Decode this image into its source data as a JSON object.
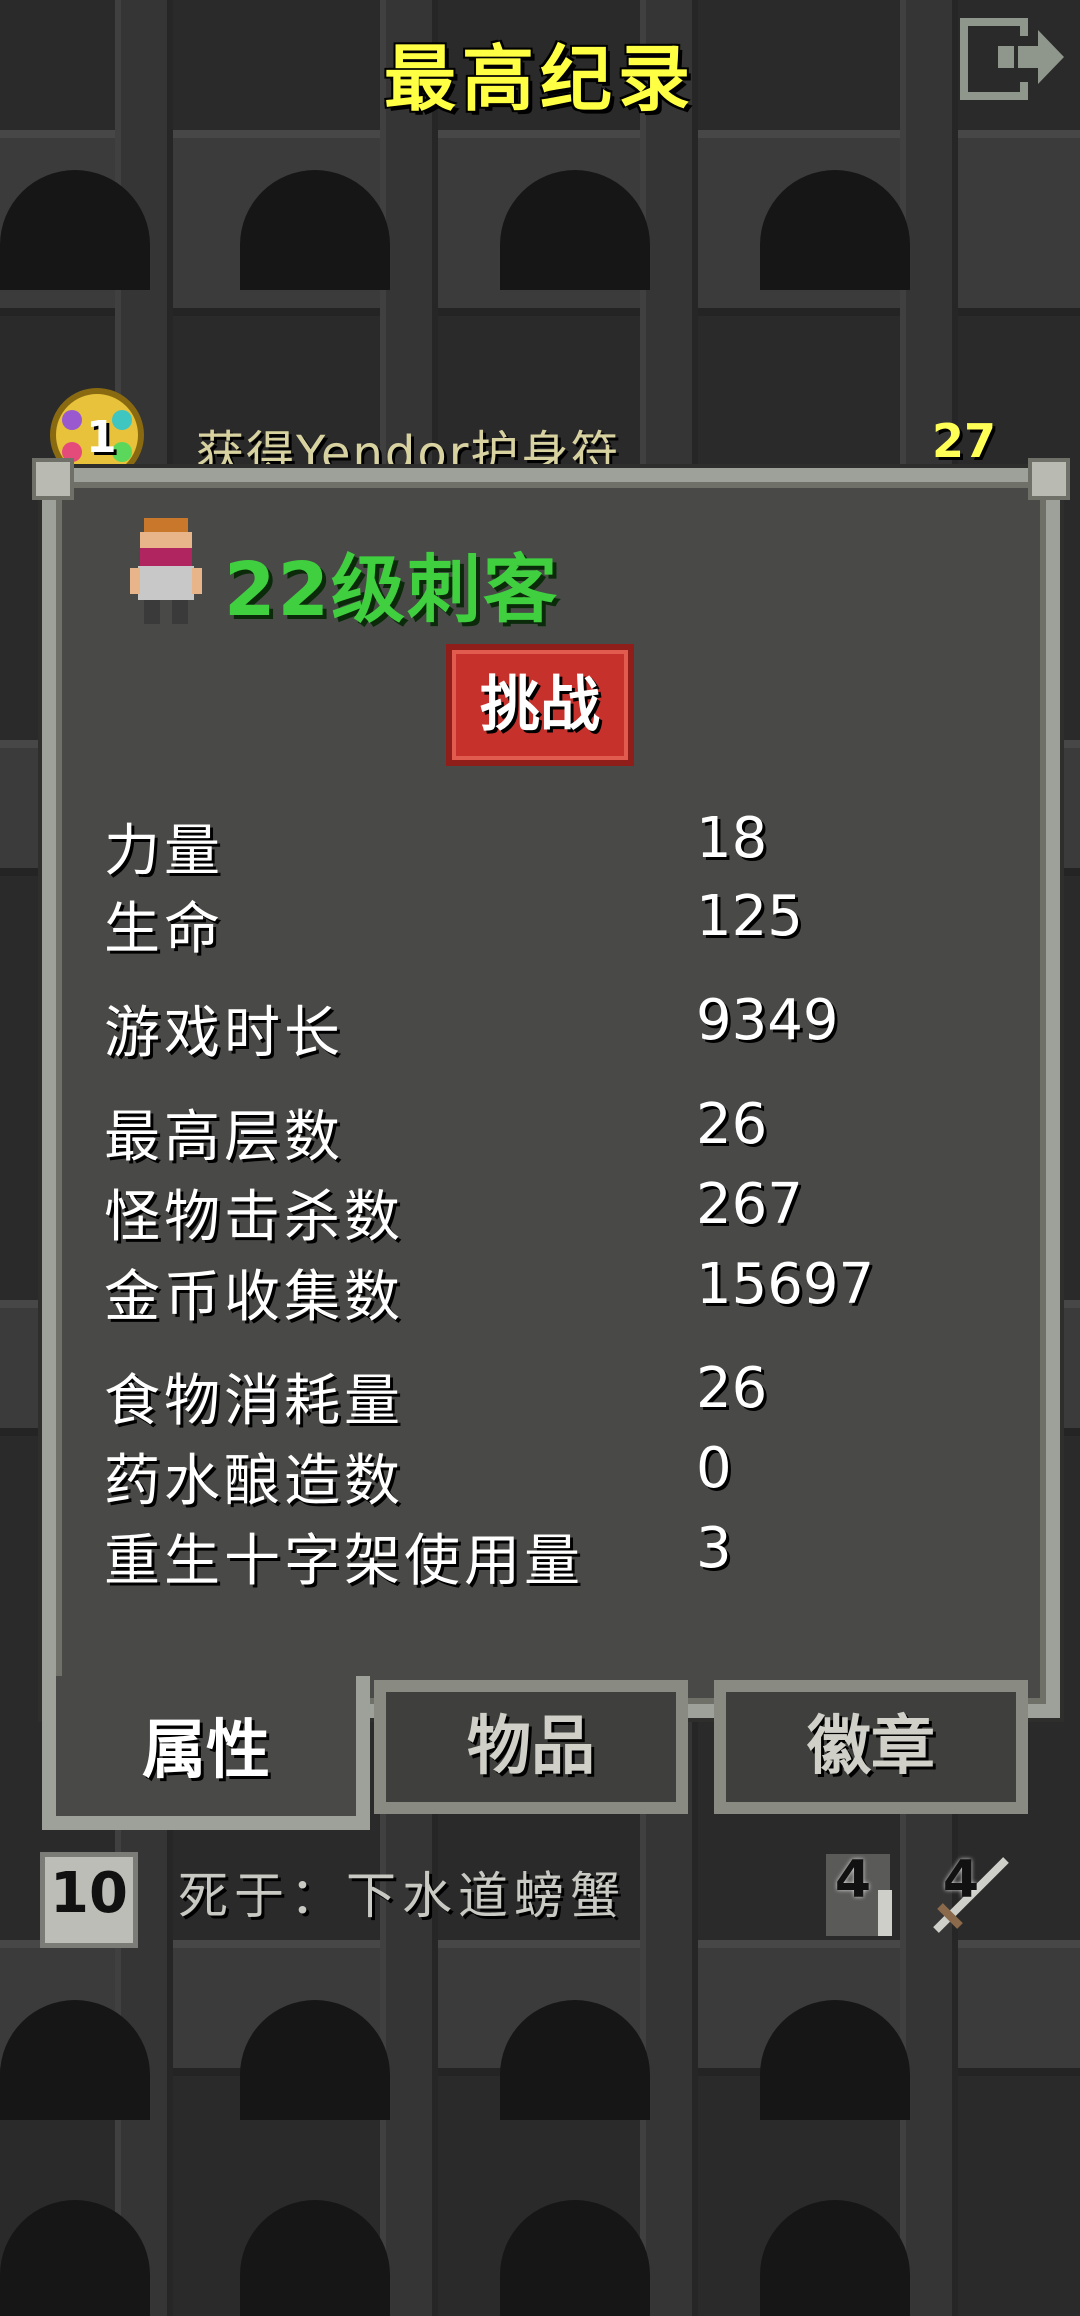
{
  "title": "最高纪录",
  "top_row": {
    "amulet_count": "1",
    "description": "获得Yendor护身符",
    "number": "27"
  },
  "hero": {
    "name": "22级刺客",
    "challenge_label": "挑战"
  },
  "stats": [
    {
      "label": "力量",
      "value": "18"
    },
    {
      "label": "生命",
      "value": "125"
    },
    {
      "label": "游戏时长",
      "value": "9349"
    },
    {
      "label": "最高层数",
      "value": "26"
    },
    {
      "label": "怪物击杀数",
      "value": "267"
    },
    {
      "label": "金币收集数",
      "value": "15697"
    },
    {
      "label": "食物消耗量",
      "value": "26"
    },
    {
      "label": "药水酿造数",
      "value": "0"
    },
    {
      "label": "重生十字架使用量",
      "value": "3"
    }
  ],
  "tabs": {
    "attributes": "属性",
    "items": "物品",
    "badges": "徽章"
  },
  "bottom_row": {
    "depth": "10",
    "death_cause": "死于：下水道螃蟹",
    "num_a": "4",
    "num_b": "4"
  },
  "colors": {
    "title": "#ffff44",
    "hero_name": "#3fcf3f",
    "challenge_button": "#c7312c",
    "panel": "#494a47",
    "panel_border": "#9ea199"
  },
  "icons": {
    "exit": "exit-icon",
    "amulet": "amulet-icon",
    "hero": "rogue-hero-icon",
    "ladder": "ladder-icon",
    "sword": "sword-icon",
    "depth": "depth-icon"
  }
}
